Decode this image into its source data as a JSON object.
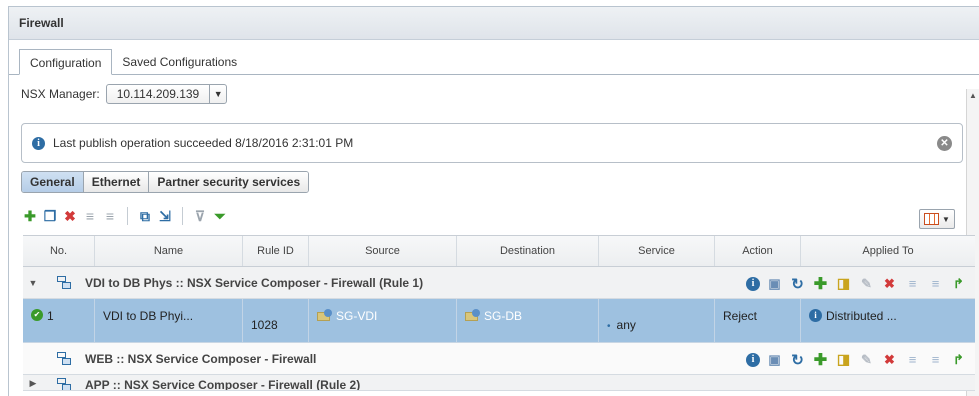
{
  "window": {
    "title": "Firewall"
  },
  "tabs": [
    {
      "label": "Configuration",
      "active": true
    },
    {
      "label": "Saved Configurations",
      "active": false
    }
  ],
  "nsx": {
    "label": "NSX Manager:",
    "value": "10.114.209.139"
  },
  "info": {
    "message": "Last publish operation succeeded 8/18/2016 2:31:01 PM"
  },
  "subtabs": [
    {
      "label": "General",
      "active": true
    },
    {
      "label": "Ethernet",
      "active": false
    },
    {
      "label": "Partner security services",
      "active": false
    }
  ],
  "table": {
    "columns": [
      "No.",
      "Name",
      "Rule ID",
      "Source",
      "Destination",
      "Service",
      "Action",
      "Applied To"
    ],
    "sections": [
      {
        "title": "VDI to DB Phys :: NSX Service Composer - Firewall (Rule 1)",
        "expanded": true
      },
      {
        "title": "WEB :: NSX Service Composer - Firewall",
        "expanded": false
      },
      {
        "title": "APP :: NSX Service Composer - Firewall (Rule 2)",
        "expanded": false
      }
    ],
    "rule": {
      "no": "1",
      "name": "VDI to DB Phyi...",
      "rule_id": "1028",
      "source": "SG-VDI",
      "destination": "SG-DB",
      "service": "any",
      "action": "Reject",
      "applied_to": "Distributed ..."
    }
  },
  "colors": {
    "selected_row": "#9ec1e0",
    "accent": "#2e6da4",
    "add": "#3a9a2a",
    "delete": "#d23a3a"
  }
}
